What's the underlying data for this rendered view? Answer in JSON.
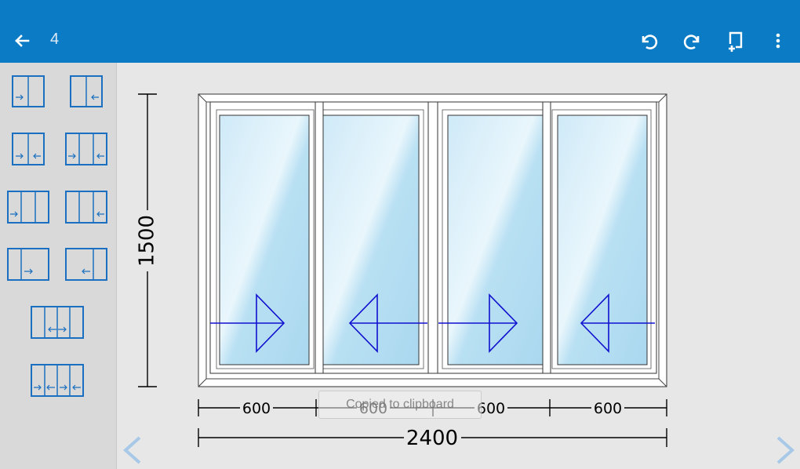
{
  "header": {
    "title": "4"
  },
  "toolbar": {
    "icons": [
      "back-arrow-icon",
      "undo-icon",
      "redo-icon",
      "add-page-icon",
      "more-vert-icon"
    ]
  },
  "sidebar": {
    "items": [
      "slide-right-fixed",
      "fixed-slide-left",
      "two-sash-converging",
      "three-sash-right-left",
      "three-sash-first-right",
      "three-sash-last-left",
      "two-sash-wide-right",
      "two-sash-wide-left",
      "three-sash-center-split",
      "four-sash-alternating"
    ]
  },
  "drawing": {
    "sash_widths": [
      "600",
      "600",
      "600",
      "600"
    ],
    "total_width": "2400",
    "height": "1500",
    "sash_directions": [
      "right",
      "left",
      "right",
      "left"
    ]
  },
  "toast": {
    "text": "Copied to clipboard"
  },
  "colors": {
    "appbar": "#0a7bc4",
    "accent": "#1a6fc0",
    "glass": "#bfe3f5",
    "arrow": "#1010d0"
  }
}
